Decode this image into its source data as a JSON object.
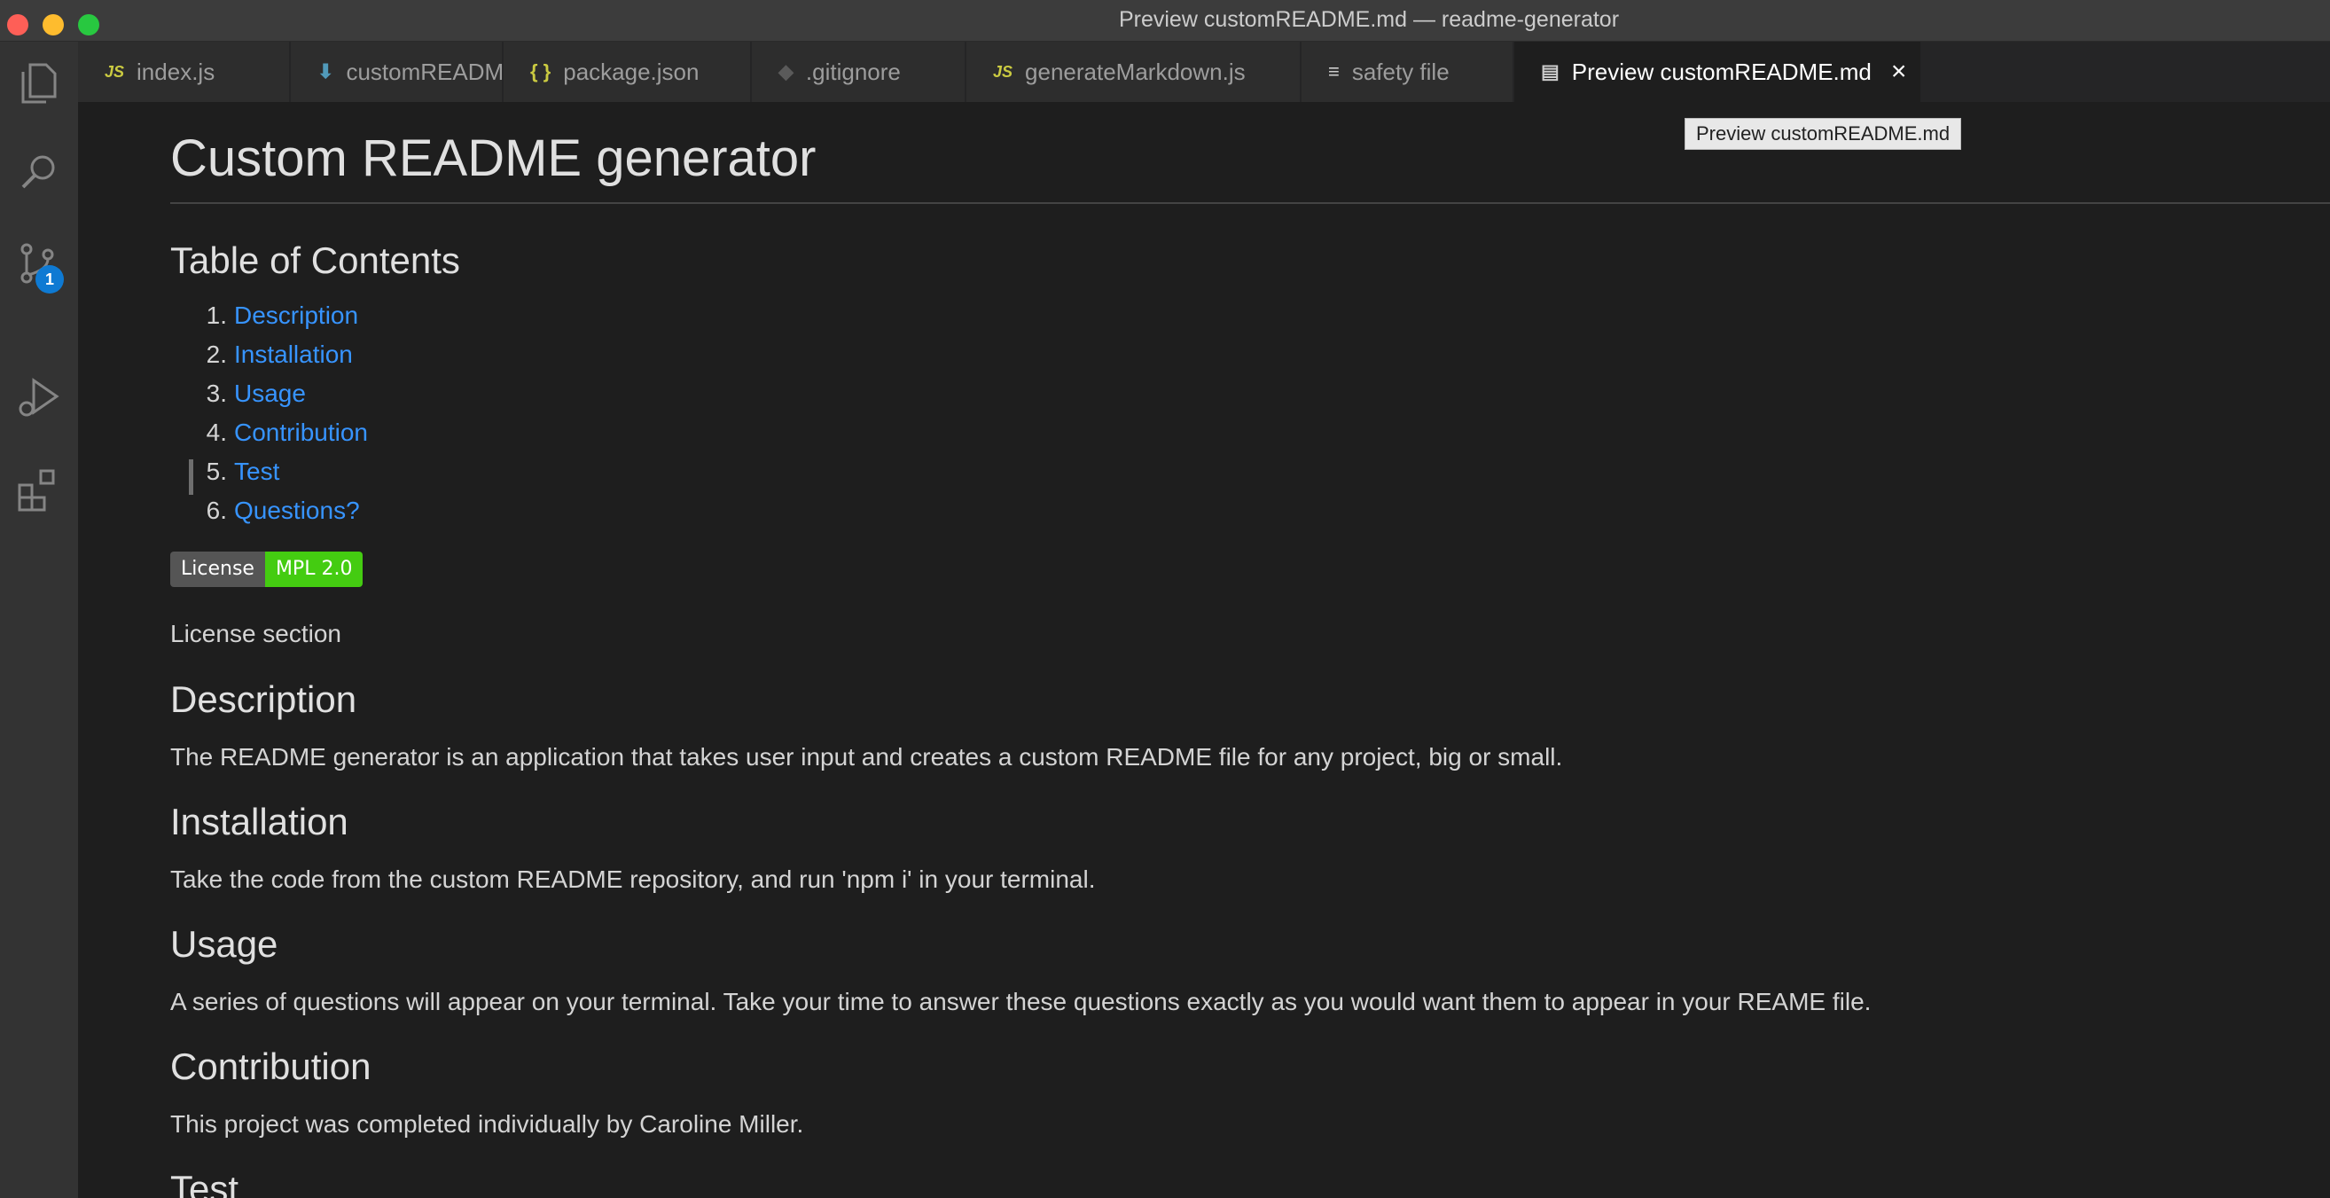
{
  "window": {
    "title": "Preview customREADME.md — readme-generator"
  },
  "activity": {
    "scm_badge": "1"
  },
  "tabs": [
    {
      "label": "index.js",
      "icon": "JS"
    },
    {
      "label": "customREADME.md",
      "icon": "markdown-icon"
    },
    {
      "label": "package.json",
      "icon": "{ }"
    },
    {
      "label": ".gitignore",
      "icon": "git-icon"
    },
    {
      "label": "generateMarkdown.js",
      "icon": "JS"
    },
    {
      "label": "safety file",
      "icon": "lines-icon"
    },
    {
      "label": "Preview customREADME.md",
      "icon": "preview-icon"
    }
  ],
  "tooltip": "Preview customREADME.md",
  "doc": {
    "title": "Custom README generator",
    "toc_heading": "Table of Contents",
    "toc": [
      {
        "num": "1.",
        "label": "Description"
      },
      {
        "num": "2.",
        "label": "Installation"
      },
      {
        "num": "3.",
        "label": "Usage"
      },
      {
        "num": "4.",
        "label": "Contribution"
      },
      {
        "num": "5.",
        "label": "Test"
      },
      {
        "num": "6.",
        "label": "Questions?"
      }
    ],
    "badge_left": "License",
    "badge_right": "MPL 2.0",
    "license_link": "License section",
    "description_heading": "Description",
    "description_text": "The README generator is an application that takes user input and creates a custom README file for any project, big or small.",
    "installation_heading": "Installation",
    "installation_text": "Take the code from the custom README repository, and run 'npm i' in your terminal.",
    "usage_heading": "Usage",
    "usage_text": "A series of questions will appear on your terminal. Take your time to answer these questions exactly as you would want them to appear in your REAME file.",
    "contribution_heading": "Contribution",
    "contribution_text": "This project was completed individually by Caroline Miller.",
    "test_heading": "Test"
  }
}
